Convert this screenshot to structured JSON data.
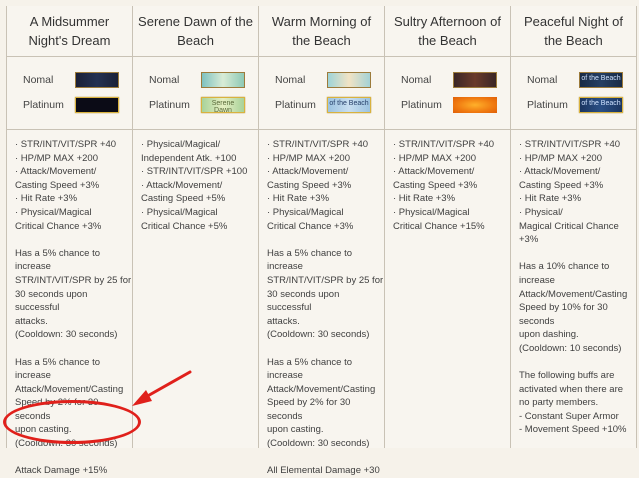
{
  "columns": [
    {
      "title": "A Midsummer Night's Dream",
      "nomal_label": "Nomal",
      "platinum_label": "Platinum",
      "nomal_text": "",
      "platinum_text": "",
      "colors": {
        "nomal": "#1b2238",
        "platinum": "#0a0a14"
      },
      "stats": "· STR/INT/VIT/SPR +40\n· HP/MP MAX +200\n· Attack/Movement/\nCasting Speed +3%\n· Hit Rate +3%\n· Physical/Magical\nCritical Chance +3%",
      "effect1": "Has a 5% chance to increase\nSTR/INT/VIT/SPR by 25 for\n30 seconds upon successful\nattacks.\n(Cooldown: 30 seconds)",
      "effect2": "Has a 5% chance to increase\nAttack/Movement/Casting\nSpeed by 2% for 30 seconds\nupon casting.\n(Cooldown: 30 seconds)",
      "effect3": "Attack Damage +15%"
    },
    {
      "title": "Serene Dawn of the Beach",
      "nomal_label": "Nomal",
      "platinum_label": "Platinum",
      "nomal_text": "",
      "platinum_text": "Serene Dawn",
      "colors": {
        "nomal": "#8fc7c4",
        "platinum": "#b9d8a8"
      },
      "stats": "· Physical/Magical/\nIndependent Atk. +100\n· STR/INT/VIT/SPR +100\n· Attack/Movement/\nCasting Speed +5%\n· Physical/Magical\nCritical Chance +5%",
      "effect1": "",
      "effect2": "",
      "effect3": ""
    },
    {
      "title": "Warm Morning of the Beach",
      "nomal_label": "Nomal",
      "platinum_label": "Platinum",
      "nomal_text": "",
      "platinum_text": "of the Beach",
      "colors": {
        "nomal": "#a9d6d9",
        "platinum": "#a7c8e4"
      },
      "stats": "· STR/INT/VIT/SPR +40\n· HP/MP MAX +200\n· Attack/Movement/\nCasting Speed +3%\n· Hit Rate +3%\n· Physical/Magical\nCritical Chance +3%",
      "effect1": "Has a 5% chance to increase\nSTR/INT/VIT/SPR by 25 for\n30 seconds upon successful\nattacks.\n(Cooldown: 30 seconds)",
      "effect2": "Has a 5% chance to increase\nAttack/Movement/Casting\nSpeed by 2% for 30 seconds\nupon casting.\n(Cooldown: 30 seconds)",
      "effect3": "All Elemental Damage +30"
    },
    {
      "title": "Sultry Afternoon of the Beach",
      "nomal_label": "Nomal",
      "platinum_label": "Platinum",
      "nomal_text": "",
      "platinum_text": "",
      "colors": {
        "nomal": "#3a2a2a",
        "platinum": "#f08a12"
      },
      "stats": "· STR/INT/VIT/SPR +40\n· HP/MP MAX +200\n· Attack/Movement/\nCasting Speed +3%\n· Hit Rate +3%\n· Physical/Magical\nCritical Chance +15%",
      "effect1": "",
      "effect2": "",
      "effect3": ""
    },
    {
      "title": "Peaceful Night of the Beach",
      "nomal_label": "Nomal",
      "platinum_label": "Platinum",
      "nomal_text": "of the Beach",
      "platinum_text": "of the Beach",
      "colors": {
        "nomal": "#1c2f4a",
        "platinum": "#1d3a66"
      },
      "stats": "· STR/INT/VIT/SPR +40\n· HP/MP MAX +200\n· Attack/Movement/\nCasting Speed +3%\n· Hit Rate +3%\n· Physical/\nMagical Critical Chance +3%",
      "effect1": "Has a 10% chance to increase\nAttack/Movement/Casting\nSpeed by 10% for 30 seconds\nupon dashing.\n(Cooldown: 10 seconds)",
      "effect2": "The following buffs are\nactivated when there are\nno party members.\n- Constant Super Armor\n- Movement Speed +10%",
      "effect3": ""
    }
  ],
  "annotation": {
    "color": "#e0201b"
  }
}
